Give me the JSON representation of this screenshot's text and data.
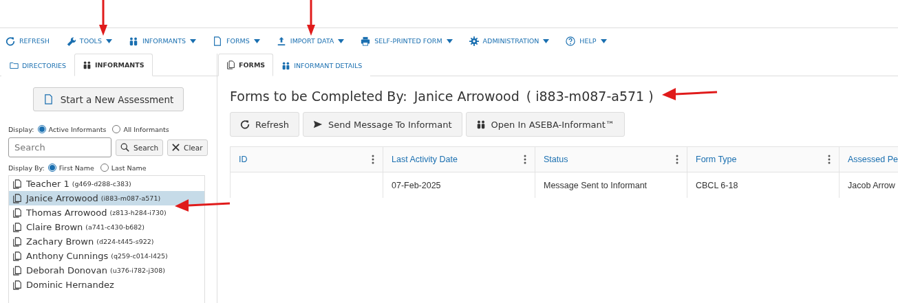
{
  "toolbar": [
    {
      "label": "REFRESH",
      "menu": false
    },
    {
      "label": "TOOLS",
      "menu": true
    },
    {
      "label": "INFORMANTS",
      "menu": true
    },
    {
      "label": "FORMS",
      "menu": true
    },
    {
      "label": "IMPORT DATA",
      "menu": true
    },
    {
      "label": "SELF-PRINTED FORM",
      "menu": true
    },
    {
      "label": "ADMINISTRATION",
      "menu": true
    },
    {
      "label": "HELP",
      "menu": true
    }
  ],
  "left_tabs": [
    {
      "label": "DIRECTORIES",
      "selected": false
    },
    {
      "label": "INFORMANTS",
      "selected": true
    }
  ],
  "right_tabs": [
    {
      "label": "FORMS",
      "selected": true
    },
    {
      "label": "INFORMANT DETAILS",
      "selected": false
    }
  ],
  "new_assessment_button": "Start a New Assessment",
  "display_filter": {
    "label": "Display:",
    "options": [
      {
        "label": "Active Informants",
        "selected": true
      },
      {
        "label": "All Informants",
        "selected": false
      }
    ]
  },
  "search": {
    "placeholder": "Search",
    "search_button": "Search",
    "clear_button": "Clear"
  },
  "display_by": {
    "label": "Display By:",
    "options": [
      {
        "label": "First Name",
        "selected": true
      },
      {
        "label": "Last Name",
        "selected": false
      }
    ]
  },
  "informants": [
    {
      "name": "Teacher 1",
      "id": "(g469-d288-c383)",
      "selected": false
    },
    {
      "name": "Janice Arrowood",
      "id": "(i883-m087-a571)",
      "selected": true
    },
    {
      "name": "Thomas Arrowood",
      "id": "(z813-h284-i730)",
      "selected": false
    },
    {
      "name": "Claire Brown",
      "id": "(a741-c430-b682)",
      "selected": false
    },
    {
      "name": "Zachary Brown",
      "id": "(d224-t445-s922)",
      "selected": false
    },
    {
      "name": "Anthony Cunnings",
      "id": "(q259-c014-l425)",
      "selected": false
    },
    {
      "name": "Deborah Donovan",
      "id": "(u376-i782-j308)",
      "selected": false
    },
    {
      "name": "Dominic Hernandez",
      "selected": false
    }
  ],
  "heading": {
    "label": "Forms to be Completed By:",
    "name": "Janice Arrowood",
    "id": "( i883-m087-a571 )"
  },
  "actions": [
    {
      "label": "Refresh"
    },
    {
      "label": "Send Message To Informant"
    },
    {
      "label": "Open In ASEBA-Informant™"
    }
  ],
  "table": {
    "columns": [
      {
        "label": "ID",
        "menu": true
      },
      {
        "label": "Last Activity Date",
        "menu": true
      },
      {
        "label": "Status",
        "menu": true
      },
      {
        "label": "Form Type",
        "menu": true
      },
      {
        "label": "Assessed Pe"
      }
    ],
    "rows": [
      [
        "",
        "07-Feb-2025",
        "Message Sent to Informant",
        "CBCL 6-18",
        "Jacob Arrow"
      ]
    ]
  }
}
